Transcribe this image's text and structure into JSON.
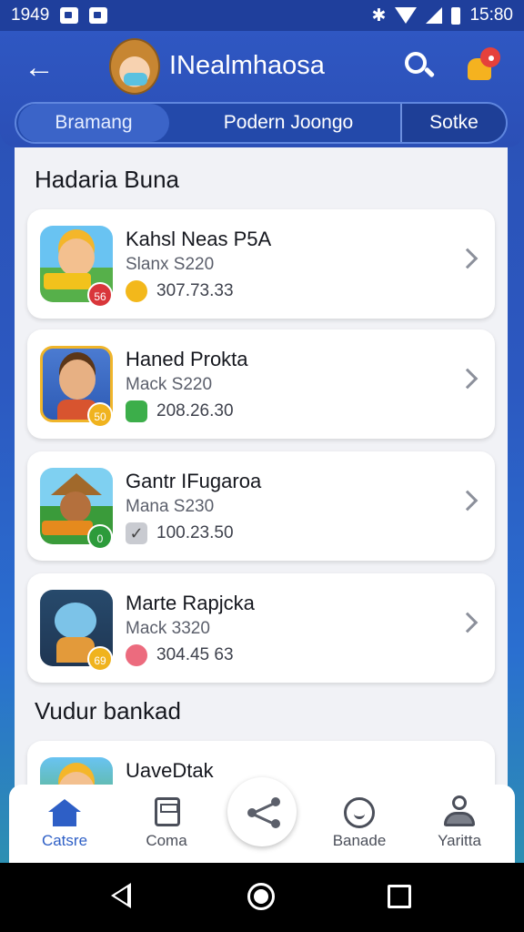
{
  "status_bar": {
    "time_left": "1949",
    "time_right": "15:80"
  },
  "header": {
    "title": "INealmhaosa",
    "tabs": [
      {
        "label": "Bramang"
      },
      {
        "label": "Podern Joongo"
      },
      {
        "label": "Sotke"
      }
    ]
  },
  "sections": [
    {
      "title": "Hadaria Buna"
    },
    {
      "title": "Vudur bankad"
    }
  ],
  "cards": [
    {
      "name": "Kahsl Neas P5A",
      "sub": "Slanx S220",
      "value": "307.73.33",
      "badge": "56",
      "badge_color": "#d9363a",
      "value_icon_color": "#f3b81b"
    },
    {
      "name": "Haned Prokta",
      "sub": "Mack S220",
      "value": "208.26.30",
      "badge": "50",
      "badge_color": "#f0b31e",
      "value_icon_color": "#3cae4a"
    },
    {
      "name": "Gantr IFugaroa",
      "sub": "Mana S230",
      "value": "100.23.50",
      "badge": "0",
      "badge_color": "#2d9b3b",
      "value_icon_color": "#c9cbd1"
    },
    {
      "name": "Marte Rapjcka",
      "sub": "Mack 3320",
      "value": "304.45 63",
      "badge": "69",
      "badge_color": "#f0b31e",
      "value_icon_color": "#ec6b7e"
    },
    {
      "name": "UaveDtak"
    }
  ],
  "bottom_nav": [
    {
      "label": "Catsre",
      "icon": "home-icon"
    },
    {
      "label": "Coma",
      "icon": "games-icon"
    },
    {
      "label": "",
      "icon": "share-icon"
    },
    {
      "label": "Banade",
      "icon": "rank-icon"
    },
    {
      "label": "Yaritta",
      "icon": "profile-icon"
    }
  ],
  "colors": {
    "accent": "#2e5fc6",
    "header_bg": "#2b4fb6"
  }
}
